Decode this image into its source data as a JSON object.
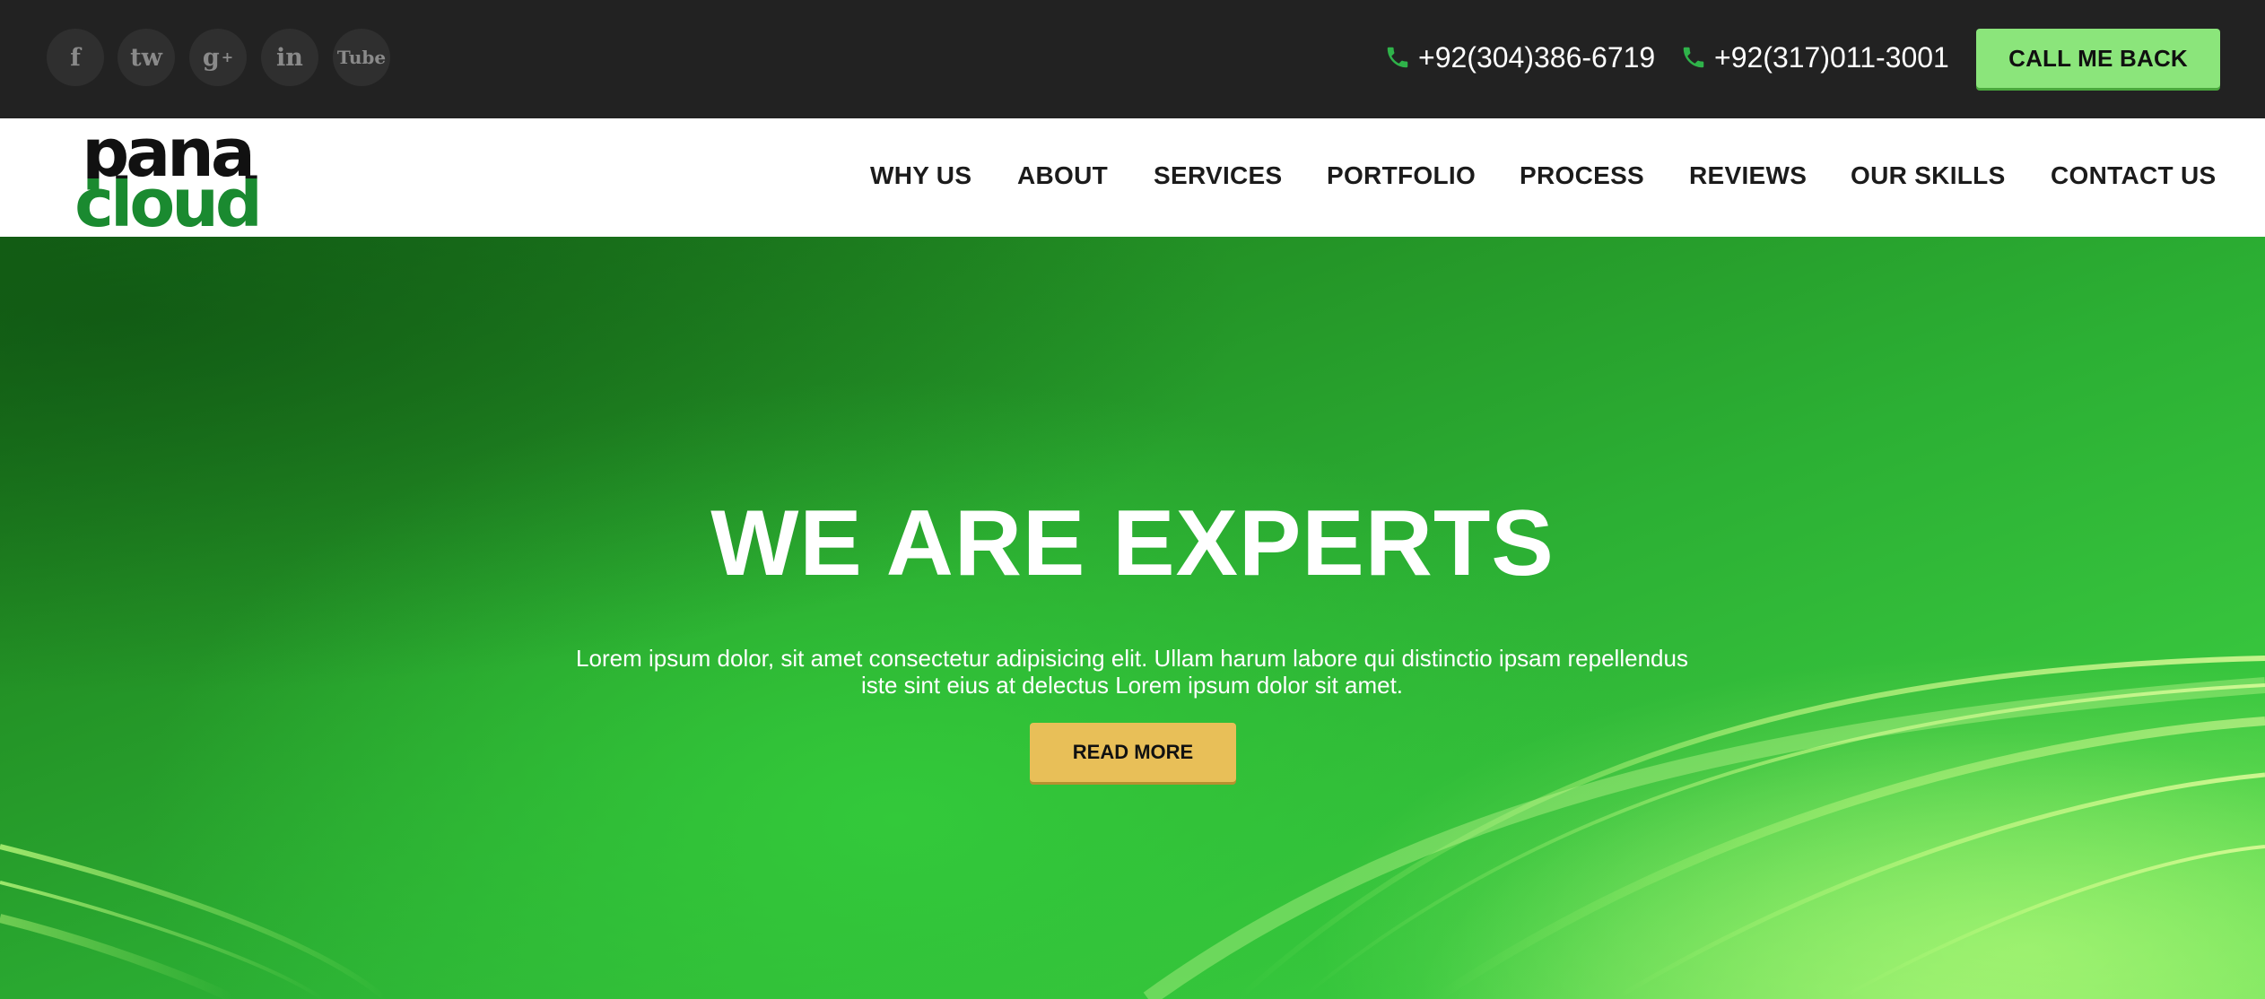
{
  "topbar": {
    "social": [
      {
        "label": "f"
      },
      {
        "label": "tw"
      },
      {
        "label": "g",
        "sup": "+"
      },
      {
        "label": "in"
      },
      {
        "label": "Tube"
      }
    ],
    "phones": [
      "+92(304)386-6719",
      "+92(317)011-3001"
    ],
    "callback_label": "CALL ME BACK",
    "icons": {
      "phone": "phone-icon"
    },
    "colors": {
      "background": "#222222",
      "phone_icon": "#2fb34a",
      "callback_bg": "#8be57b"
    }
  },
  "header": {
    "logo": {
      "line1": "pana",
      "line2": "cloud",
      "colors": {
        "top": "#111111",
        "bottom": "#1a8a30"
      }
    },
    "nav": [
      "WHY US",
      "ABOUT",
      "SERVICES",
      "PORTFOLIO",
      "PROCESS",
      "REVIEWS",
      "OUR SKILLS",
      "CONTACT US"
    ]
  },
  "hero": {
    "title": "WE ARE EXPERTS",
    "text_line1": "Lorem ipsum dolor, sit amet consectetur adipisicing elit. Ullam harum labore qui distinctio ipsam repellendus",
    "text_line2": "iste sint eius at delectus Lorem ipsum dolor sit amet.",
    "button_label": "READ MORE",
    "colors": {
      "accent": "#e8bf58",
      "background": "#2cb034"
    }
  }
}
